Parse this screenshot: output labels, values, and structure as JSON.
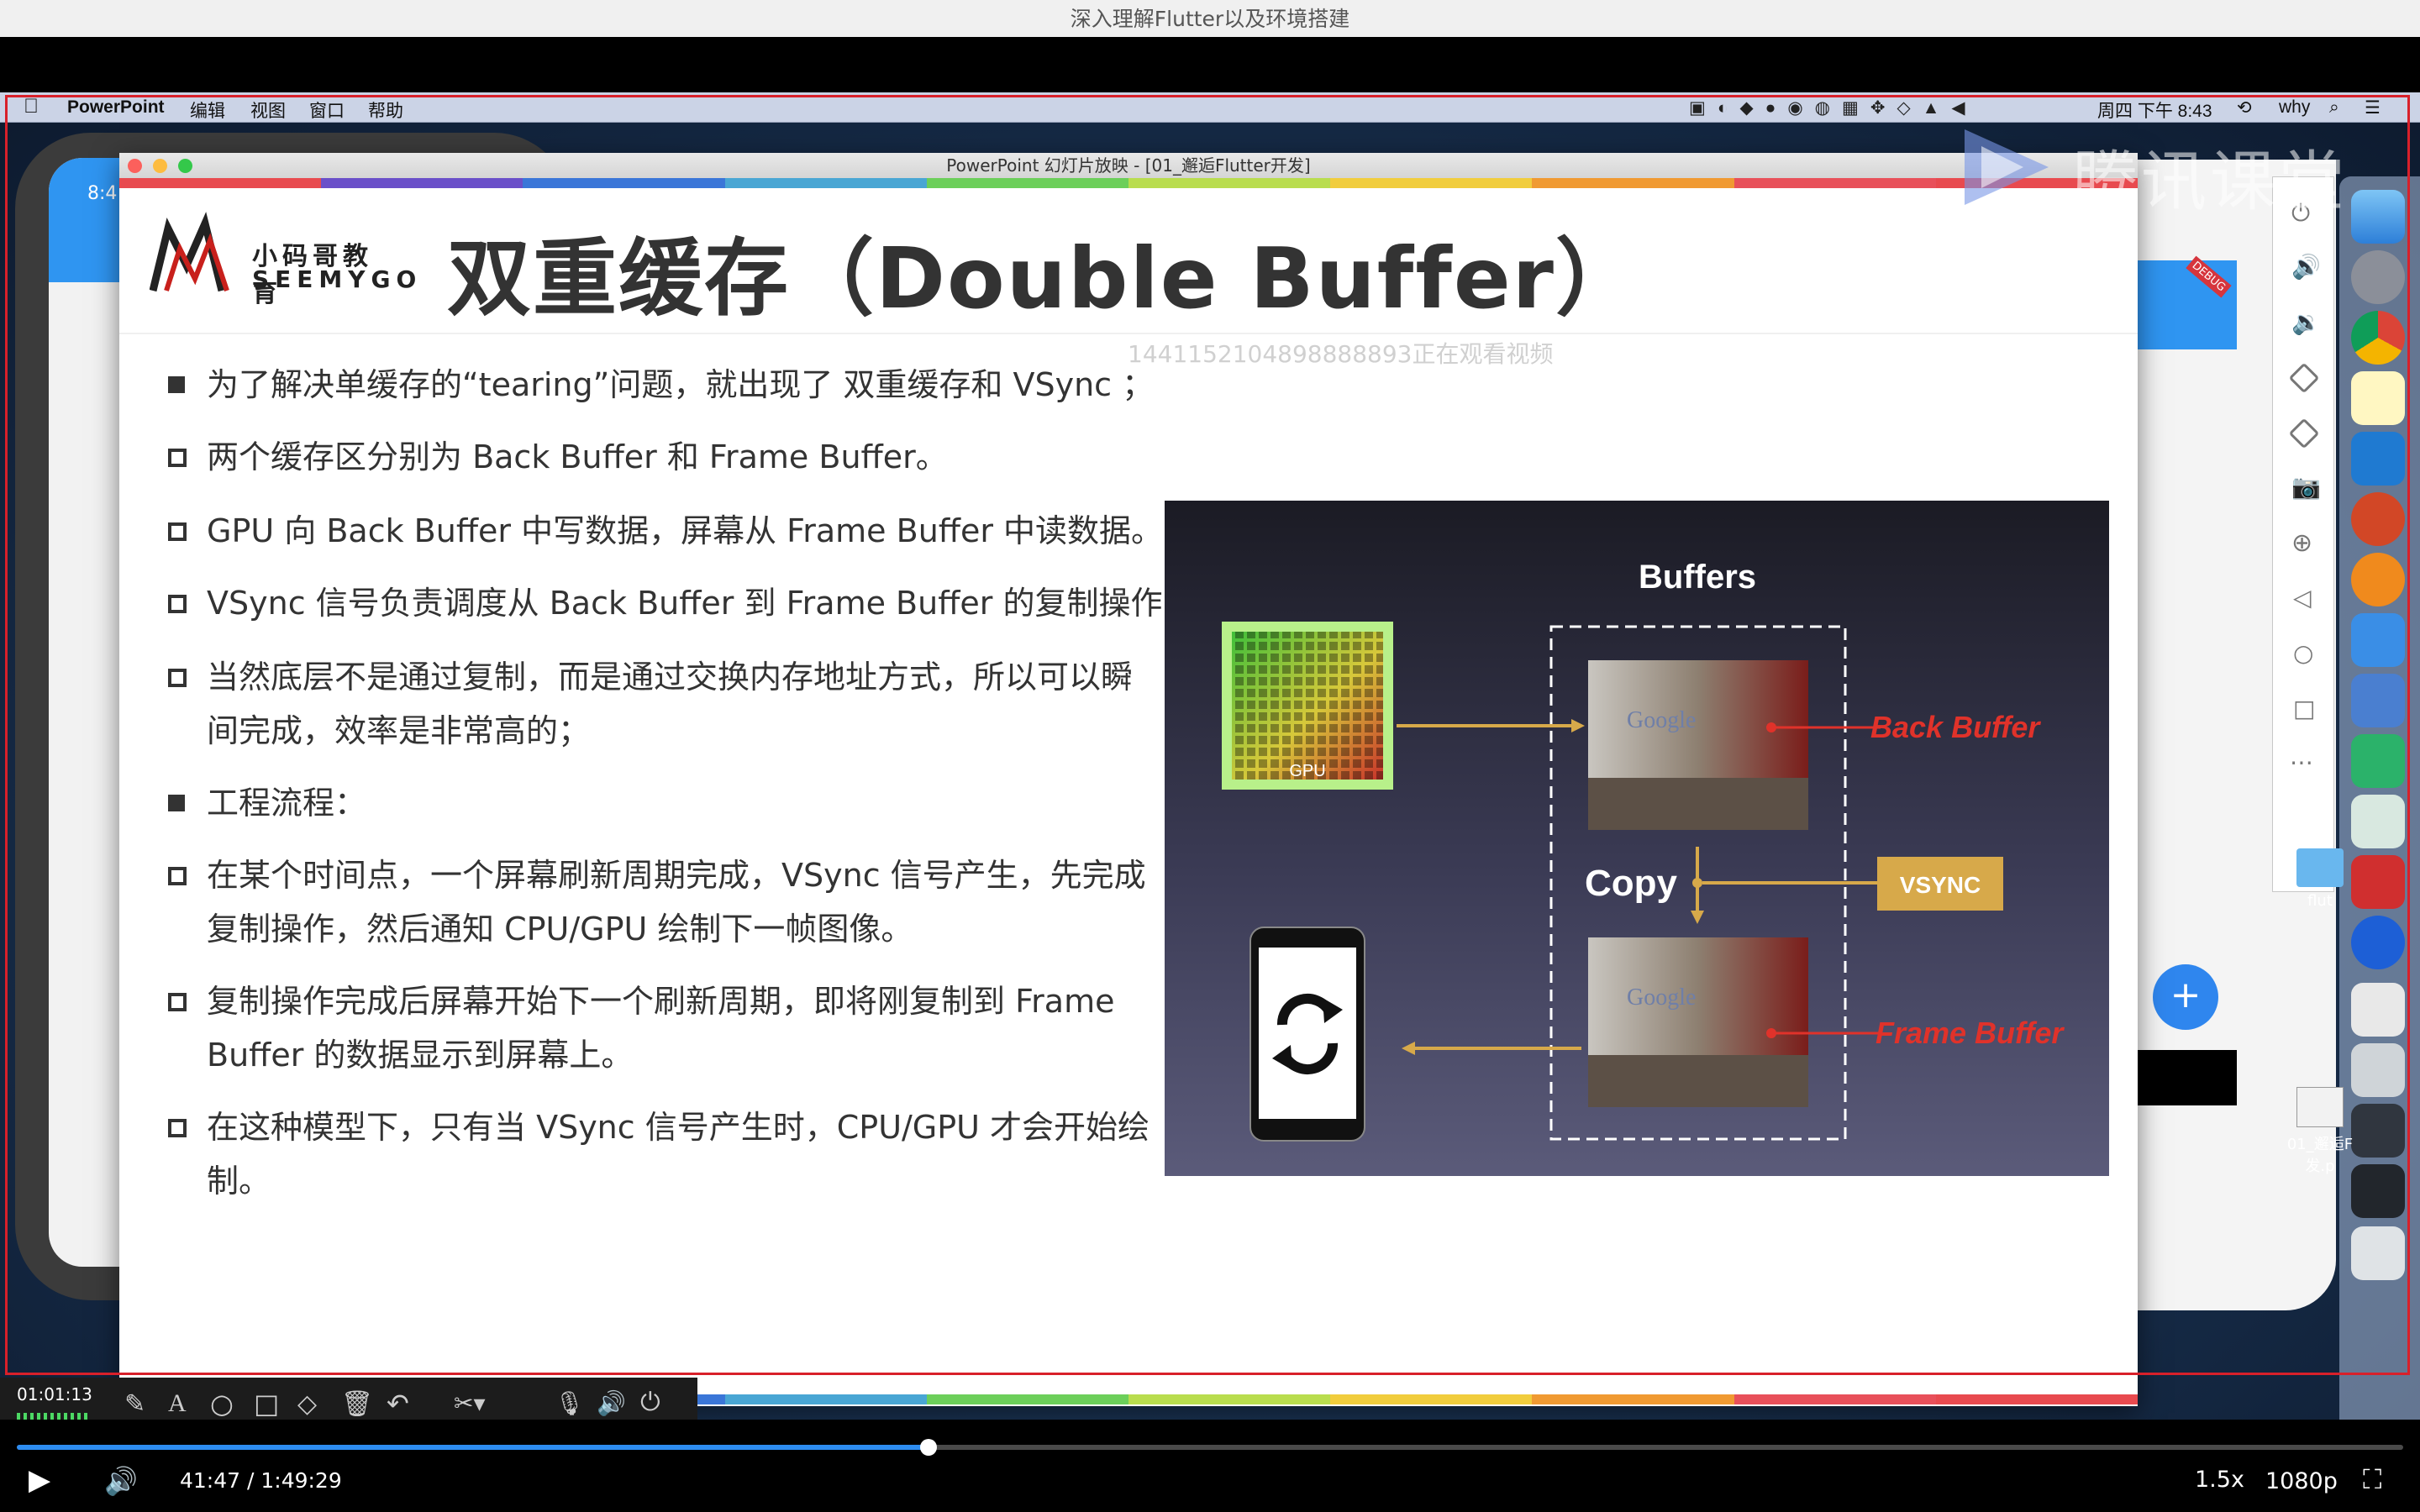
{
  "player": {
    "title": "深入理解Flutter以及环境搭建",
    "elapsed_total": "41:47 / 1:49:29",
    "speed": "1.5x",
    "quality": "1080p",
    "progress_fraction": 0.382
  },
  "annotation_bar": {
    "timer": "01:01:13"
  },
  "mac_menubar": {
    "app": "PowerPoint",
    "items": [
      "编辑",
      "视图",
      "窗口",
      "帮助"
    ],
    "clock": "周四 下午 8:43",
    "user": "why"
  },
  "watermark": {
    "brand": "腾讯课堂",
    "viewer": "1441152104898888893正在观看视频"
  },
  "simulator": {
    "left_time": "8:4",
    "right_badge": "DEBUG"
  },
  "desktop": {
    "folder_label": "flut",
    "file_label_line1": "01_邂逅F",
    "file_label_line2": "发.p"
  },
  "ppt": {
    "window_title": "PowerPoint 幻灯片放映 - [01_邂逅Flutter开发]",
    "logo_cn": "小码哥教育",
    "logo_en": "SEEMYGO",
    "slide_title": "双重缓存（Double Buffer）",
    "bullets": [
      {
        "style": "solid",
        "text": "为了解决单缓存的“tearing”问题，就出现了 双重缓存和 VSync ；"
      },
      {
        "style": "hollow",
        "text": "两个缓存区分别为 Back Buffer 和 Frame Buffer。"
      },
      {
        "style": "hollow",
        "text": "GPU 向 Back Buffer 中写数据，屏幕从 Frame Buffer 中读数据。"
      },
      {
        "style": "hollow",
        "text": "VSync 信号负责调度从 Back Buffer 到 Frame Buffer 的复制操作"
      },
      {
        "style": "hollow",
        "text": "当然底层不是通过复制，而是通过交换内存地址方式，所以可以瞬间完成，效率是非常高的；"
      },
      {
        "style": "solid",
        "text": "工程流程："
      },
      {
        "style": "hollow",
        "text": "在某个时间点，一个屏幕刷新周期完成，VSync 信号产生，先完成复制操作，然后通知 CPU/GPU 绘制下一帧图像。"
      },
      {
        "style": "hollow",
        "text": "复制操作完成后屏幕开始下一个刷新周期，即将刚复制到 Frame Buffer 的数据显示到屏幕上。"
      },
      {
        "style": "hollow",
        "text": "在这种模型下，只有当 VSync 信号产生时，CPU/GPU 才会开始绘制。"
      }
    ],
    "diagram": {
      "title": "Buffers",
      "gpu_label": "GPU",
      "back_buffer": "Back Buffer",
      "frame_buffer": "Frame Buffer",
      "copy": "Copy",
      "vsync": "VSYNC",
      "photo_text": "Google"
    }
  },
  "colors": {
    "accent_blue": "#2d8cf0",
    "diagram_red": "#e0322a",
    "diagram_gold": "#d7a94a",
    "rainbow": [
      "#e84a4f",
      "#6a4fc9",
      "#3a76d8",
      "#49a6d4",
      "#6ccf5a",
      "#b9dd4e",
      "#f1cd3d",
      "#f09a32",
      "#e8505a",
      "#e84a4f"
    ]
  }
}
